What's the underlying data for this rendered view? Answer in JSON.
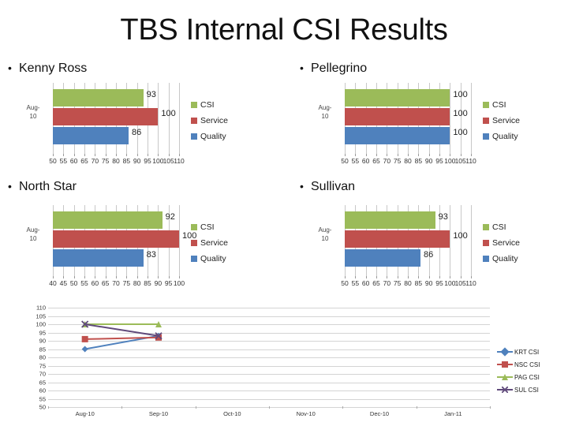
{
  "slide": {
    "title": "TBS Internal CSI Results"
  },
  "bullets": {
    "marker": "•",
    "kenny_ross": "Kenny Ross",
    "pellegrino": "Pellegrino",
    "north_star": "North Star",
    "sullivan": "Sullivan"
  },
  "colors": {
    "csi": "#9BBB59",
    "service": "#C0504D",
    "quality": "#4F81BD",
    "krt": "#4F81BD",
    "nsc": "#C0504D",
    "pag": "#9BBB59",
    "sul": "#604A7B"
  },
  "legend_labels": {
    "csi": "CSI",
    "service": "Service",
    "quality": "Quality"
  },
  "chart_data": [
    {
      "id": "kenny-ross",
      "type": "bar",
      "title": "Kenny Ross",
      "orientation": "horizontal",
      "categories": [
        "Aug-10"
      ],
      "category_label_lines": [
        "Aug-",
        "10"
      ],
      "series": [
        {
          "name": "CSI",
          "values": [
            93
          ],
          "color": "#9BBB59"
        },
        {
          "name": "Service",
          "values": [
            100
          ],
          "color": "#C0504D"
        },
        {
          "name": "Quality",
          "values": [
            86
          ],
          "color": "#4F81BD"
        }
      ],
      "xlim": [
        50,
        110
      ],
      "xticks": [
        50,
        55,
        60,
        65,
        70,
        75,
        80,
        85,
        90,
        95,
        100,
        105,
        110
      ],
      "ylabel": "",
      "xlabel": "",
      "grid": true,
      "legend_position": "right"
    },
    {
      "id": "pellegrino",
      "type": "bar",
      "title": "Pellegrino",
      "orientation": "horizontal",
      "categories": [
        "Aug-10"
      ],
      "category_label_lines": [
        "Aug-",
        "10"
      ],
      "series": [
        {
          "name": "CSI",
          "values": [
            100
          ],
          "color": "#9BBB59"
        },
        {
          "name": "Service",
          "values": [
            100
          ],
          "color": "#C0504D"
        },
        {
          "name": "Quality",
          "values": [
            100
          ],
          "color": "#4F81BD"
        }
      ],
      "xlim": [
        50,
        110
      ],
      "xticks": [
        50,
        55,
        60,
        65,
        70,
        75,
        80,
        85,
        90,
        95,
        100,
        105,
        110
      ],
      "ylabel": "",
      "xlabel": "",
      "grid": true,
      "legend_position": "right"
    },
    {
      "id": "north-star",
      "type": "bar",
      "title": "North Star",
      "orientation": "horizontal",
      "categories": [
        "Aug-10"
      ],
      "category_label_lines": [
        "Aug-",
        "10"
      ],
      "series": [
        {
          "name": "CSI",
          "values": [
            92
          ],
          "color": "#9BBB59"
        },
        {
          "name": "Service",
          "values": [
            100
          ],
          "color": "#C0504D"
        },
        {
          "name": "Quality",
          "values": [
            83
          ],
          "color": "#4F81BD"
        }
      ],
      "xlim": [
        40,
        100
      ],
      "xticks": [
        40,
        45,
        50,
        55,
        60,
        65,
        70,
        75,
        80,
        85,
        90,
        95,
        100
      ],
      "ylabel": "",
      "xlabel": "",
      "grid": true,
      "legend_position": "right"
    },
    {
      "id": "sullivan",
      "type": "bar",
      "title": "Sullivan",
      "orientation": "horizontal",
      "categories": [
        "Aug-10"
      ],
      "category_label_lines": [
        "Aug-",
        "10"
      ],
      "series": [
        {
          "name": "CSI",
          "values": [
            93
          ],
          "color": "#9BBB59"
        },
        {
          "name": "Service",
          "values": [
            100
          ],
          "color": "#C0504D"
        },
        {
          "name": "Quality",
          "values": [
            86
          ],
          "color": "#4F81BD"
        }
      ],
      "xlim": [
        50,
        110
      ],
      "xticks": [
        50,
        55,
        60,
        65,
        70,
        75,
        80,
        85,
        90,
        95,
        100,
        105,
        110
      ],
      "ylabel": "",
      "xlabel": "",
      "grid": true,
      "legend_position": "right"
    },
    {
      "id": "csi-trend",
      "type": "line",
      "title": "",
      "x": [
        "Aug-10",
        "Sep-10",
        "Oct-10",
        "Nov-10",
        "Dec-10",
        "Jan-11"
      ],
      "series": [
        {
          "name": "KRT CSI",
          "values": [
            85,
            93,
            null,
            null,
            null,
            null
          ],
          "color": "#4F81BD",
          "marker": "diamond"
        },
        {
          "name": "NSC CSI",
          "values": [
            91,
            92,
            null,
            null,
            null,
            null
          ],
          "color": "#C0504D",
          "marker": "square"
        },
        {
          "name": "PAG CSI",
          "values": [
            100,
            100,
            null,
            null,
            null,
            null
          ],
          "color": "#9BBB59",
          "marker": "triangle"
        },
        {
          "name": "SUL CSI",
          "values": [
            100,
            93,
            null,
            null,
            null,
            null
          ],
          "color": "#604A7B",
          "marker": "x"
        }
      ],
      "ylim": [
        50,
        110
      ],
      "yticks": [
        110,
        105,
        100,
        95,
        90,
        85,
        80,
        75,
        70,
        65,
        60,
        55,
        50
      ],
      "xlabel": "",
      "ylabel": "",
      "grid": true,
      "legend_position": "right"
    }
  ]
}
